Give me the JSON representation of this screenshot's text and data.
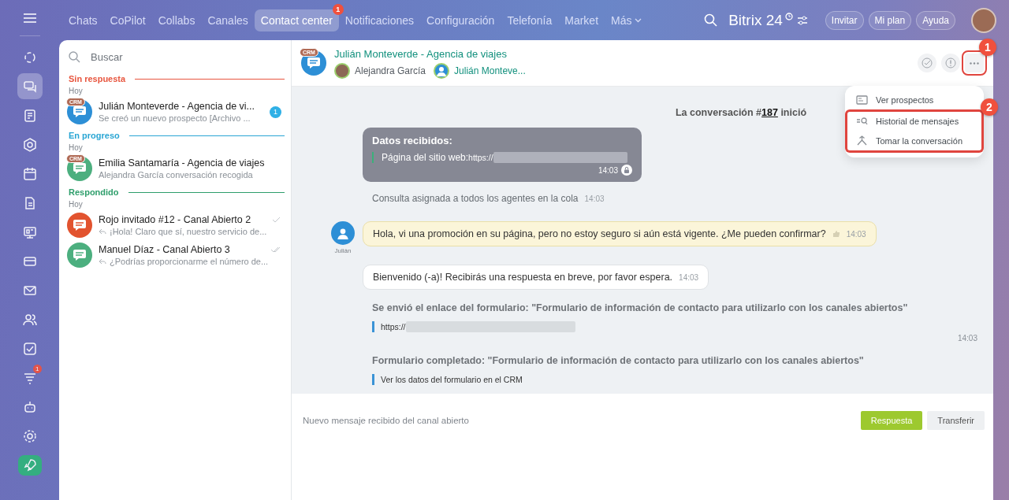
{
  "nav": {
    "tabs": [
      {
        "label": "Chats",
        "selected": false
      },
      {
        "label": "CoPilot",
        "selected": false
      },
      {
        "label": "Collabs",
        "selected": false
      },
      {
        "label": "Canales",
        "selected": false
      },
      {
        "label": "Contact center",
        "selected": true,
        "badge": "1"
      },
      {
        "label": "Notificaciones",
        "selected": false
      },
      {
        "label": "Configuración",
        "selected": false
      },
      {
        "label": "Telefonía",
        "selected": false
      },
      {
        "label": "Market",
        "selected": false
      },
      {
        "label": "Más",
        "selected": false,
        "dropdown": true
      }
    ],
    "brand": "Bitrix 24",
    "buttons": [
      "Invitar",
      "Mi plan",
      "Ayuda"
    ]
  },
  "rail": [
    {
      "selected": false
    },
    {
      "selected": true
    },
    {
      "selected": false
    },
    {
      "selected": false
    },
    {
      "selected": false
    },
    {
      "selected": false
    },
    {
      "selected": false
    },
    {
      "selected": false
    },
    {
      "selected": false
    },
    {
      "selected": false
    },
    {
      "selected": false
    },
    {
      "selected": false,
      "badge": "1"
    },
    {
      "selected": false
    },
    {
      "selected": false
    },
    {
      "selected": false
    }
  ],
  "sidebar": {
    "search": {
      "placeholder": "Buscar"
    },
    "groups": [
      {
        "title": "Sin respuesta",
        "color": "#e8563f",
        "date": "Hoy",
        "chats": [
          {
            "name": "Julián Monteverde - Agencia de vi...",
            "preview": "Se creó un nuevo prospecto [Archivo ...",
            "color": "#2d8fd6",
            "crm": "CRM",
            "unread": "1",
            "replied": false
          }
        ]
      },
      {
        "title": "En progreso",
        "color": "#2aa6d4",
        "date": "Hoy",
        "chats": [
          {
            "name": "Emilia Santamaría - Agencia de viajes",
            "preview": "Alejandra García conversación recogida",
            "color": "#4caf7f",
            "crm": "CRM",
            "replied": false
          }
        ]
      },
      {
        "title": "Respondido",
        "color": "#2e9e6b",
        "date": "Hoy",
        "chats": [
          {
            "name": "Rojo invitado #12 - Canal Abierto 2",
            "preview": "¡Hola! Claro que sí, nuestro servicio de...",
            "color": "#e2532f",
            "replied": true,
            "read": false
          },
          {
            "name": "Manuel Díaz - Canal Abierto 3",
            "preview": "¿Podrías proporcionarme el número de...",
            "color": "#4caf7f",
            "replied": true,
            "read": true
          }
        ]
      }
    ]
  },
  "chat": {
    "title": "Julián Monteverde - Agencia de viajes",
    "crm": "CRM",
    "participants": [
      {
        "name": "Alejandra García",
        "kind": "operator"
      },
      {
        "name": "Julián Monteve...",
        "kind": "client"
      }
    ],
    "menu": [
      {
        "label": "Ver prospectos",
        "highlighted": false
      },
      {
        "label": "Historial de mensajes",
        "highlighted": true
      },
      {
        "label": "Tomar la conversación",
        "highlighted": true
      }
    ],
    "annotations": [
      {
        "label": "1"
      },
      {
        "label": "2"
      }
    ],
    "messages": [
      {
        "kind": "start",
        "before": "La conversación #",
        "link": "187",
        "after": " inició"
      },
      {
        "kind": "data",
        "title": "Datos recibidos:",
        "label": "Página del sitio web:",
        "value": "https://",
        "time": "14:03"
      },
      {
        "kind": "note",
        "text": "Consulta asignada a todos los agentes en la cola",
        "time": "14:03"
      },
      {
        "kind": "incoming",
        "author": "Julián",
        "text": "Hola, vi una promoción en su página, pero no estoy seguro si aún está vigente. ¿Me pueden confirmar?",
        "time": "14:03"
      },
      {
        "kind": "outgoing",
        "text": "Bienvenido (-a)! Recibirás una respuesta en breve, por favor espera.",
        "time": "14:03"
      },
      {
        "kind": "form_link",
        "title": "Se envió el enlace del formulario: \"Formulario de información de contacto para utilizarlo con los canales abiertos\"",
        "value": "https://",
        "time": "14:03"
      },
      {
        "kind": "form_done",
        "title": "Formulario completado: \"Formulario de información de contacto para utilizarlo con los canales abiertos\"",
        "link": "Ver los datos del formulario en el CRM"
      }
    ],
    "footer": {
      "text": "Nuevo mensaje recibido del canal abierto",
      "buttons": [
        {
          "label": "Respuesta",
          "primary": true
        },
        {
          "label": "Transferir",
          "primary": false
        }
      ]
    }
  }
}
